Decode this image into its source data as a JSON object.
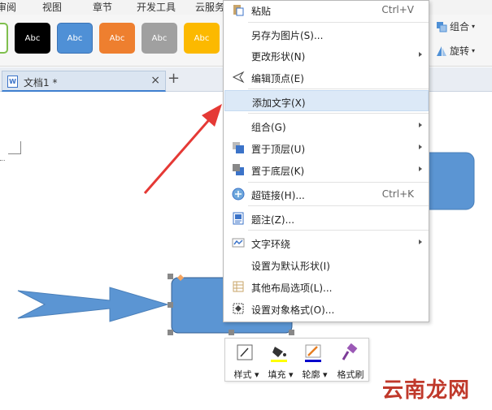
{
  "menubar": {
    "items": [
      "审阅",
      "视图",
      "章节",
      "开发工具",
      "云服务"
    ]
  },
  "ribbon": {
    "swatches": [
      {
        "label": "Abc",
        "color": "#000000"
      },
      {
        "label": "Abc",
        "color": "#4f90d6"
      },
      {
        "label": "Abc",
        "color": "#ee7f2f"
      },
      {
        "label": "Abc",
        "color": "#a0a0a0"
      },
      {
        "label": "Abc",
        "color": "#fcb900"
      }
    ],
    "group_label": "组合",
    "rotate_label": "旋转"
  },
  "tabs": {
    "doc_name": "文档1 *",
    "close_glyph": "×",
    "new_tab_glyph": "+"
  },
  "context_menu": {
    "paste": {
      "label": "粘贴",
      "shortcut": "Ctrl+V"
    },
    "save_as_image": "另存为图片(S)...",
    "change_shape": "更改形状(N)",
    "edit_vertices": "编辑顶点(E)",
    "add_text": "添加文字(X)",
    "group": "组合(G)",
    "bring_to_front": "置于顶层(U)",
    "send_to_back": "置于底层(K)",
    "hyperlink": {
      "label": "超链接(H)...",
      "shortcut": "Ctrl+K"
    },
    "caption": "题注(Z)...",
    "text_wrap": "文字环绕",
    "set_default": "设置为默认形状(I)",
    "more_layout": "其他布局选项(L)...",
    "format_object": "设置对象格式(O)..."
  },
  "float_toolbar": {
    "style": "样式",
    "fill": "填充",
    "outline": "轮廓",
    "format_painter": "格式刷"
  },
  "watermark": "云南龙网",
  "colors": {
    "shape_blue": "#5b95d3",
    "highlight": "#dce9f7",
    "arrow_red": "#e53935"
  }
}
